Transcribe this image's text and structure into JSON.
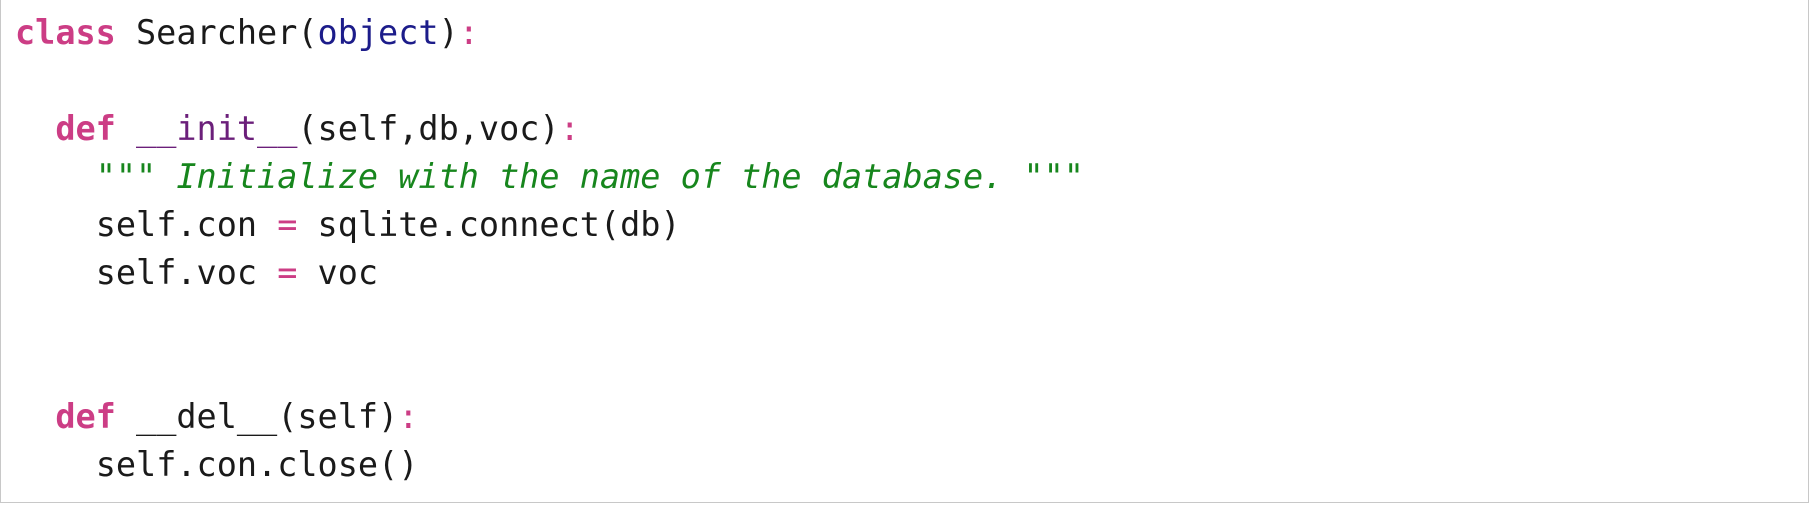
{
  "code": {
    "line1": {
      "keyword": "class",
      "class_name": " Searcher(",
      "base": "object",
      "close": ")",
      "colon": ":"
    },
    "line3": {
      "indent": "  ",
      "keyword": "def",
      "space": " ",
      "method": "__init__",
      "params": "(self,db,voc)",
      "colon": ":"
    },
    "line4": {
      "indent": "    ",
      "open_quote": "\"\"\"",
      "text": " Initialize with the name of the database. ",
      "close_quote": "\"\"\""
    },
    "line5": {
      "indent": "    ",
      "target": "self.con ",
      "op": "=",
      "value": " sqlite.connect(db)"
    },
    "line6": {
      "indent": "    ",
      "target": "self.voc ",
      "op": "=",
      "value": " voc"
    },
    "line9": {
      "indent": "  ",
      "keyword": "def",
      "rest": " __del__(self)",
      "colon": ":"
    },
    "line10": {
      "indent": "    ",
      "text": "self.con.close()"
    }
  },
  "colors": {
    "keyword": "#cc3d85",
    "builtin": "#1c1c8a",
    "dunder": "#6b1f7a",
    "docstring": "#17861d",
    "text": "#1a1a1a"
  }
}
